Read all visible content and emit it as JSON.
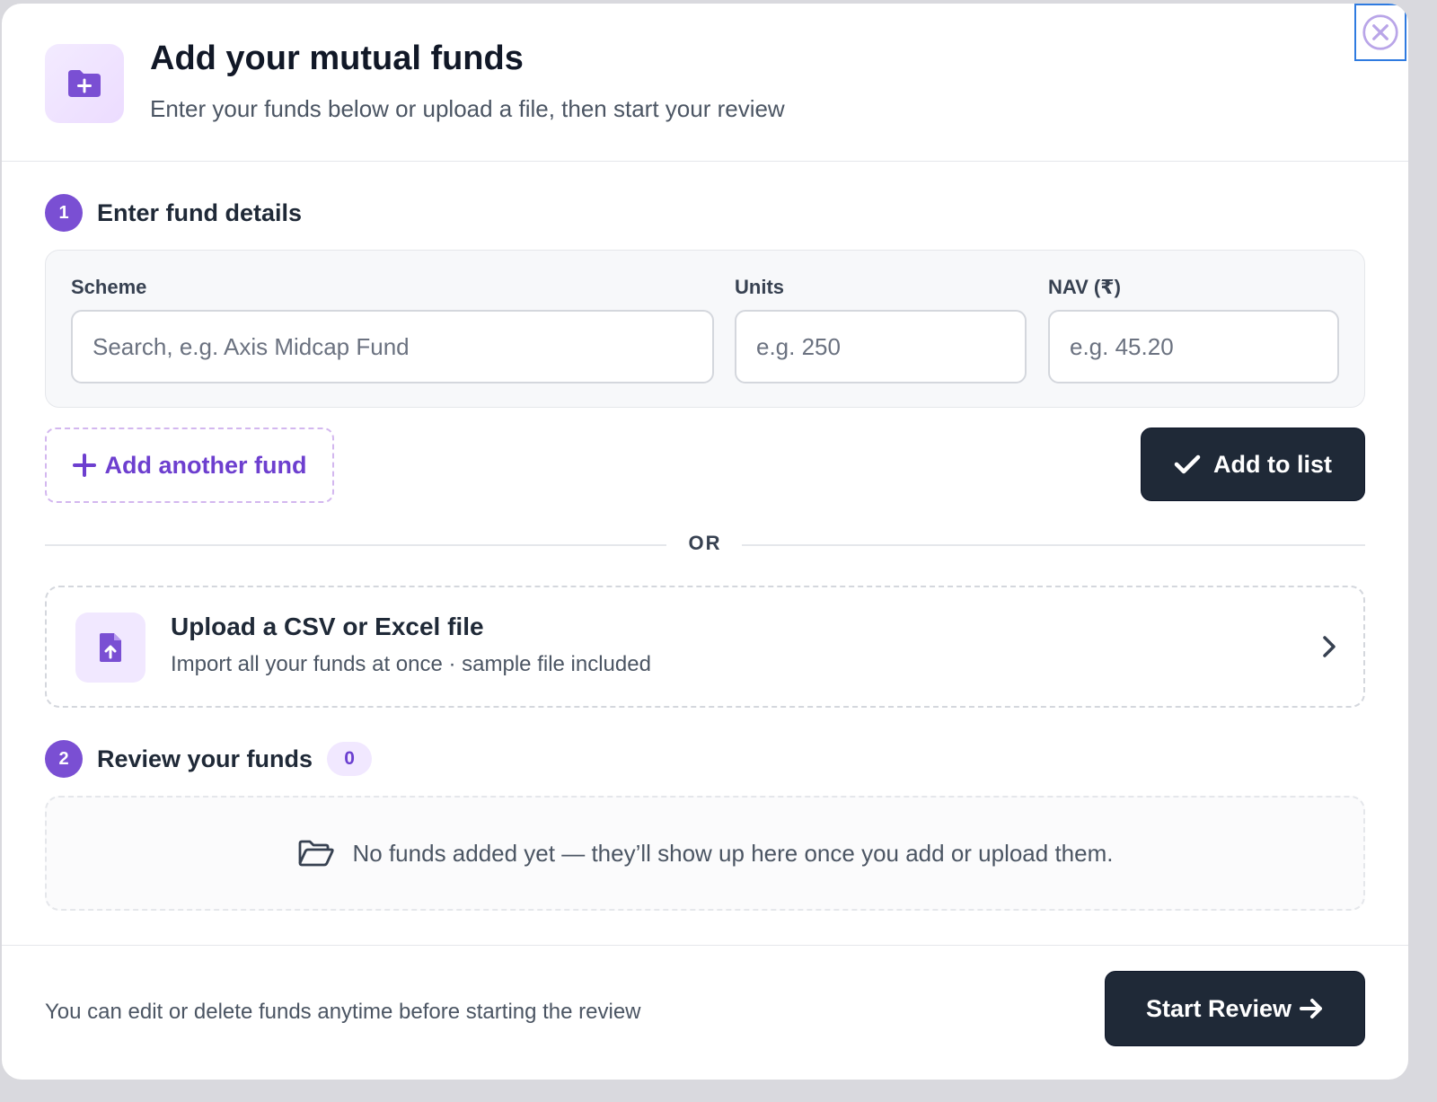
{
  "header": {
    "title": "Add your mutual funds",
    "subtitle": "Enter your funds below or upload a file, then start your review",
    "icon": "folder-plus-icon"
  },
  "close": {
    "icon": "close-circle-icon"
  },
  "step1": {
    "number": "1",
    "label": "Enter fund details",
    "fields": {
      "scheme_label": "Scheme",
      "scheme_placeholder": "Search, e.g. Axis Midcap Fund",
      "units_label": "Units",
      "units_placeholder": "e.g. 250",
      "nav_label": "NAV (₹)",
      "nav_placeholder": "e.g. 45.20"
    },
    "add_another_label": "Add another fund",
    "add_to_list_label": "Add to list"
  },
  "divider": {
    "text": "OR"
  },
  "upload": {
    "title": "Upload a CSV or Excel file",
    "subtitle": "Import all your funds at once · sample file included",
    "icon": "file-upload-icon"
  },
  "step2": {
    "number": "2",
    "label": "Review your funds",
    "count": "0",
    "empty_text": "No funds added yet — they’ll show up here once you add or upload them.",
    "empty_icon": "open-folder-icon"
  },
  "footer": {
    "note": "You can edit or delete funds anytime before starting the review",
    "start_label": "Start Review"
  },
  "colors": {
    "accent": "#7a4fd3",
    "accent_light": "#f1e8ff",
    "primary_button": "#1f2937",
    "focus_outline": "#2f7be0"
  }
}
